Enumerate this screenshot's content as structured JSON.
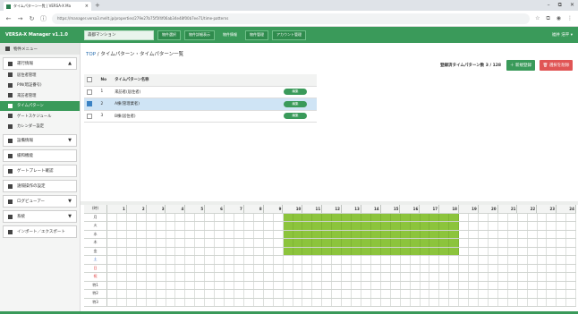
{
  "browser": {
    "tab_title": "タイムパターン一覧 | VERSA-X Ma",
    "url": "https://manager.versa3.mellt.jp/properties/279e27b75f5f4f06ab34e48f00b7ee71/time-patterns",
    "controls": {
      "minimize": "–",
      "restore": "⧉",
      "close": "✕",
      "new_tab": "+",
      "back": "←",
      "forward": "→",
      "reload": "↻",
      "info": "ⓘ"
    }
  },
  "app": {
    "name": "VERSA-X Manager v1.1.0",
    "property": "森都マンション",
    "header_buttons": [
      "物件選択",
      "物件詳細表示",
      "物件情報",
      "物件管理",
      "アカウント管理"
    ],
    "user": "福井 浩平 ▾"
  },
  "sidebar": {
    "title": "物件メニュー",
    "groups": [
      {
        "label": "運行情報",
        "arrow": "▲"
      },
      {
        "label": "設備情報",
        "arrow": "▼"
      },
      {
        "label": "緩和機能",
        "arrow": ""
      },
      {
        "label": "ゲートプレート確認",
        "arrow": ""
      },
      {
        "label": "遠隔操作の設定",
        "arrow": ""
      },
      {
        "label": "ログビューアー",
        "arrow": "▼"
      },
      {
        "label": "系統",
        "arrow": "▼"
      },
      {
        "label": "インポート／エクスポート",
        "arrow": ""
      }
    ],
    "items": [
      "居住者管理",
      "PIN(暗証番号)",
      "来訪者管理",
      "タイムパターン",
      "ゲートスケジュール",
      "カレンダー設定"
    ],
    "active_item": "タイムパターン"
  },
  "main": {
    "breadcrumb": {
      "top": "TOP",
      "sep": "/",
      "current": "タイムパターン・タイムパターン一覧"
    },
    "count_label": "登録済タイムパターン数 3 / 128",
    "new_button": "＋ 新規登録",
    "delete_button": "🗑 選択を削除",
    "table": {
      "headers": [
        "No",
        "タイムパターン名称"
      ],
      "rows": [
        {
          "no": "1",
          "name": "来訪者(居住者)",
          "checked": false,
          "selected": false,
          "action": "編集"
        },
        {
          "no": "2",
          "name": "A棟(管理業者)",
          "checked": true,
          "selected": true,
          "action": "編集"
        },
        {
          "no": "3",
          "name": "B棟(居住者)",
          "checked": false,
          "selected": false,
          "action": "編集"
        }
      ]
    }
  },
  "schedule": {
    "corner": "(時)",
    "hours": [
      "0",
      "1",
      "2",
      "3",
      "4",
      "5",
      "6",
      "7",
      "8",
      "9",
      "10",
      "11",
      "12",
      "13",
      "14",
      "15",
      "16",
      "17",
      "18",
      "19",
      "20",
      "21",
      "22",
      "23",
      "24"
    ],
    "days": [
      {
        "label": "月",
        "type": "weekday"
      },
      {
        "label": "火",
        "type": "weekday"
      },
      {
        "label": "水",
        "type": "weekday"
      },
      {
        "label": "木",
        "type": "weekday"
      },
      {
        "label": "金",
        "type": "weekday"
      },
      {
        "label": "土",
        "type": "sat"
      },
      {
        "label": "日",
        "type": "sun"
      },
      {
        "label": "祝",
        "type": "sun"
      },
      {
        "label": "特1",
        "type": "weekday"
      },
      {
        "label": "特2",
        "type": "weekday"
      },
      {
        "label": "特3",
        "type": "weekday"
      }
    ],
    "active_days": [
      "月",
      "火",
      "水",
      "木",
      "金"
    ],
    "active_start_hour": 9,
    "active_end_hour": 18,
    "active_color": "#8cc43c"
  },
  "colors": {
    "accent": "#3a9a5a",
    "danger": "#e05555",
    "selection": "#cfe4f5"
  }
}
